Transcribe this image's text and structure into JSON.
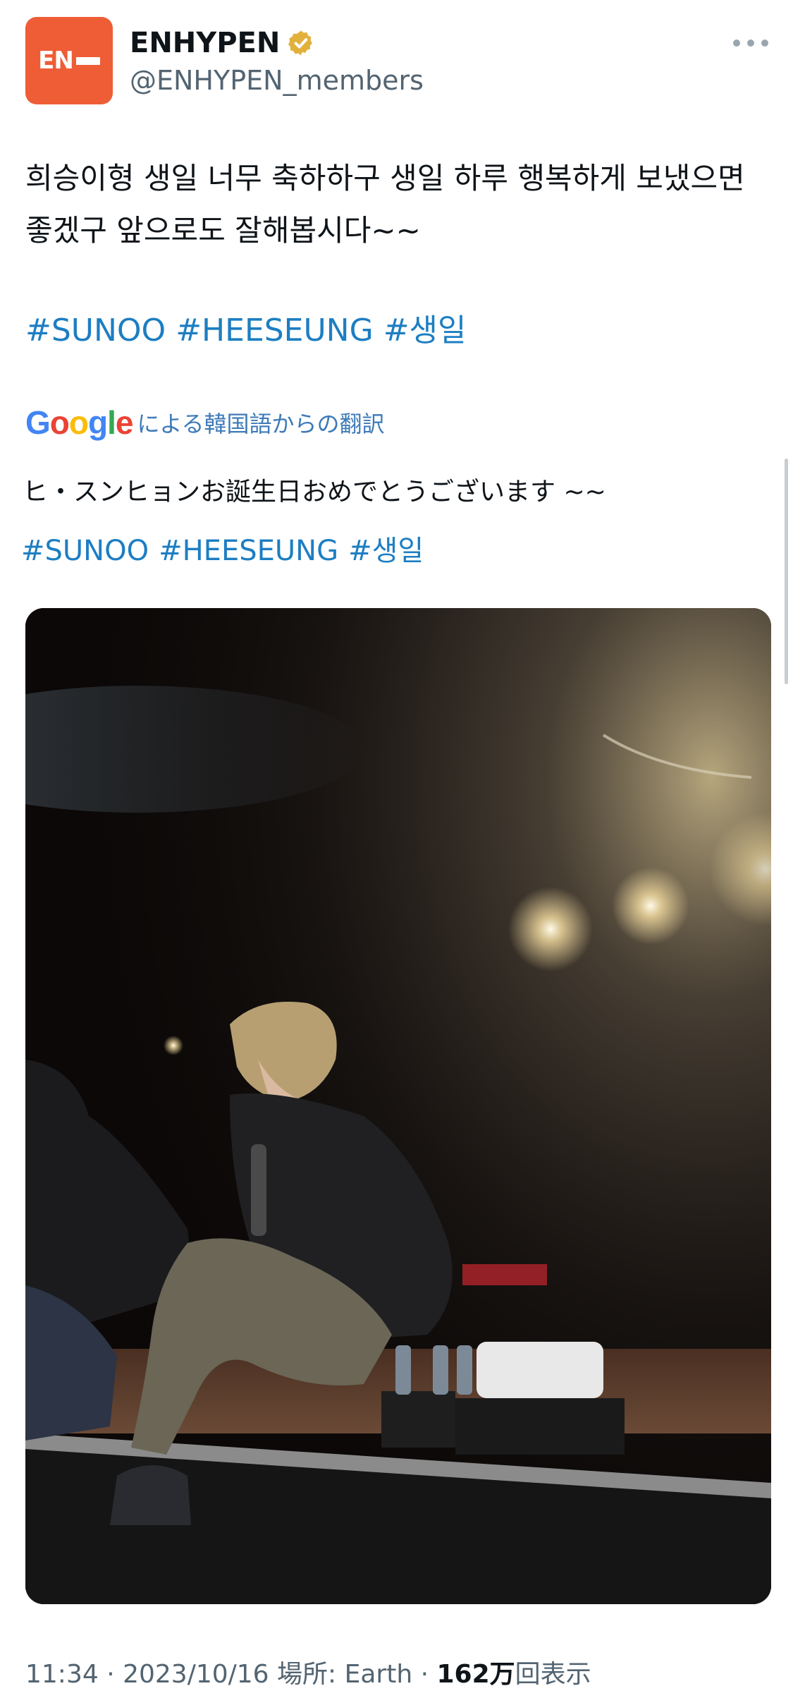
{
  "account": {
    "avatar_text": "EN",
    "display_name": "ENHYPEN",
    "handle": "@ENHYPEN_members",
    "verified_icon": "verified-badge-icon",
    "more_icon": "more-options-icon"
  },
  "tweet": {
    "text": "희승이형 생일 너무 축하하구 생일 하루 행복하게 보냈으면 좋겠구 앞으로도 잘해봅시다~~",
    "hashtags": [
      "#SUNOO",
      "#HEESEUNG",
      "#생일"
    ]
  },
  "translation": {
    "provider_logo": "Google",
    "label": "による韓国語からの翻訳",
    "text": "ヒ・スンヒョンお誕生日おめでとうございます ~~",
    "hashtags": [
      "#SUNOO",
      "#HEESEUNG",
      "#생일"
    ]
  },
  "meta": {
    "time": "11:34",
    "sep1": " · ",
    "date": "2023/10/16",
    "location": " 場所: Earth",
    "sep2": " · ",
    "views_count": "162万",
    "views_label": "回表示"
  },
  "colors": {
    "avatar": "#ee5d36",
    "link": "#1d7ec2",
    "secondary_text": "#536471",
    "verified": "#e2b13c"
  }
}
